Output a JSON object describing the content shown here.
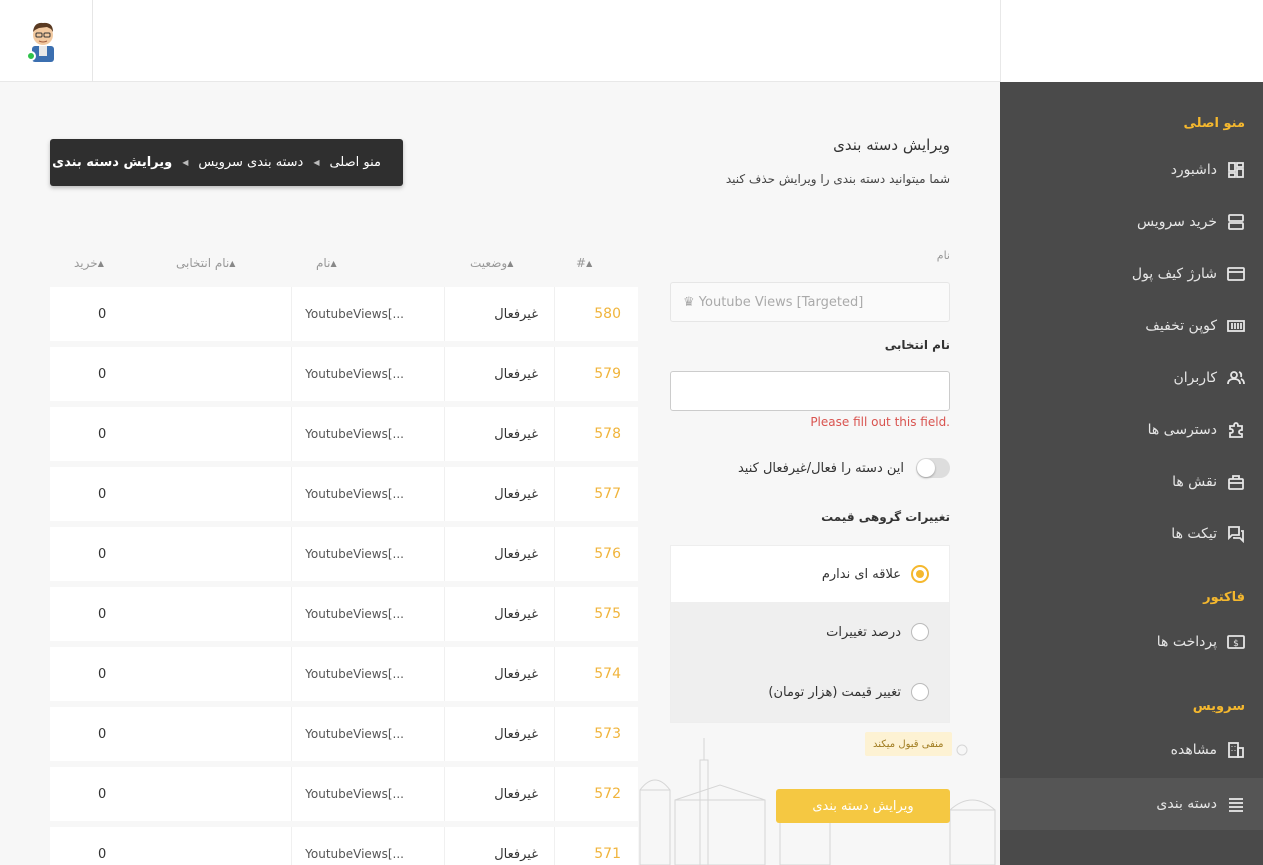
{
  "header": {
    "avatar": "user-avatar",
    "status": "online"
  },
  "sidebar": {
    "sections": [
      {
        "title": "منو اصلی"
      },
      {
        "title": "فاکتور"
      },
      {
        "title": "سرویس"
      }
    ],
    "items": [
      {
        "label": "داشبورد",
        "icon": "dashboard-icon"
      },
      {
        "label": "خرید سرویس",
        "icon": "server-icon"
      },
      {
        "label": "شارژ کیف پول",
        "icon": "wallet-icon"
      },
      {
        "label": "کوپن تخفیف",
        "icon": "coupon-icon"
      },
      {
        "label": "کاربران",
        "icon": "users-icon"
      },
      {
        "label": "دسترسی ها",
        "icon": "puzzle-icon"
      },
      {
        "label": "نقش ها",
        "icon": "briefcase-icon"
      },
      {
        "label": "تیکت ها",
        "icon": "chat-icon"
      },
      {
        "label": "پرداخت ها",
        "icon": "money-icon"
      },
      {
        "label": "مشاهده",
        "icon": "building-icon"
      },
      {
        "label": "دسته بندی",
        "icon": "list-icon"
      }
    ]
  },
  "breadcrumb": [
    "منو اصلی",
    "دسته بندی سرویس",
    "ویرایش دسته بندی"
  ],
  "form": {
    "title": "ویرایش دسته بندی",
    "subtitle": "شما میتوانید دسته بندی را ویرایش حذف کنید",
    "name_label": "نام",
    "name_value": "♛ Youtube Views [Targeted]",
    "choice_label": "نام انتخابی",
    "error": "Please fill out this field.",
    "toggle_label": "این دسته را فعال/غیرفعال کنید",
    "price_label": "تغییرات گروهی قیمت",
    "radio_options": [
      "علاقه ای ندارم",
      "درصد تغییرات",
      "تغییر قیمت (هزار تومان)"
    ],
    "hint": "منفی قبول میکند",
    "submit": "ویرایش دسته بندی"
  },
  "table": {
    "headers": {
      "id": "#",
      "status": "وضعیت",
      "name": "نام",
      "choice": "نام انتخابی",
      "buy": "خرید"
    },
    "rows": [
      {
        "id": "580",
        "status": "غیرفعال",
        "name": "YoutubeViews[...",
        "choice": "",
        "buy": "0"
      },
      {
        "id": "579",
        "status": "غیرفعال",
        "name": "YoutubeViews[...",
        "choice": "",
        "buy": "0"
      },
      {
        "id": "578",
        "status": "غیرفعال",
        "name": "YoutubeViews[...",
        "choice": "",
        "buy": "0"
      },
      {
        "id": "577",
        "status": "غیرفعال",
        "name": "YoutubeViews[...",
        "choice": "",
        "buy": "0"
      },
      {
        "id": "576",
        "status": "غیرفعال",
        "name": "YoutubeViews[...",
        "choice": "",
        "buy": "0"
      },
      {
        "id": "575",
        "status": "غیرفعال",
        "name": "YoutubeViews[...",
        "choice": "",
        "buy": "0"
      },
      {
        "id": "574",
        "status": "غیرفعال",
        "name": "YoutubeViews[...",
        "choice": "",
        "buy": "0"
      },
      {
        "id": "573",
        "status": "غیرفعال",
        "name": "YoutubeViews[...",
        "choice": "",
        "buy": "0"
      },
      {
        "id": "572",
        "status": "غیرفعال",
        "name": "YoutubeViews[...",
        "choice": "",
        "buy": "0"
      },
      {
        "id": "571",
        "status": "غیرفعال",
        "name": "YoutubeViews[...",
        "choice": "",
        "buy": "0"
      }
    ]
  },
  "colors": {
    "accent": "#f5b82e",
    "sidebar": "#4a4a4a",
    "id_link": "#f0b43c",
    "error": "#d9534f"
  }
}
